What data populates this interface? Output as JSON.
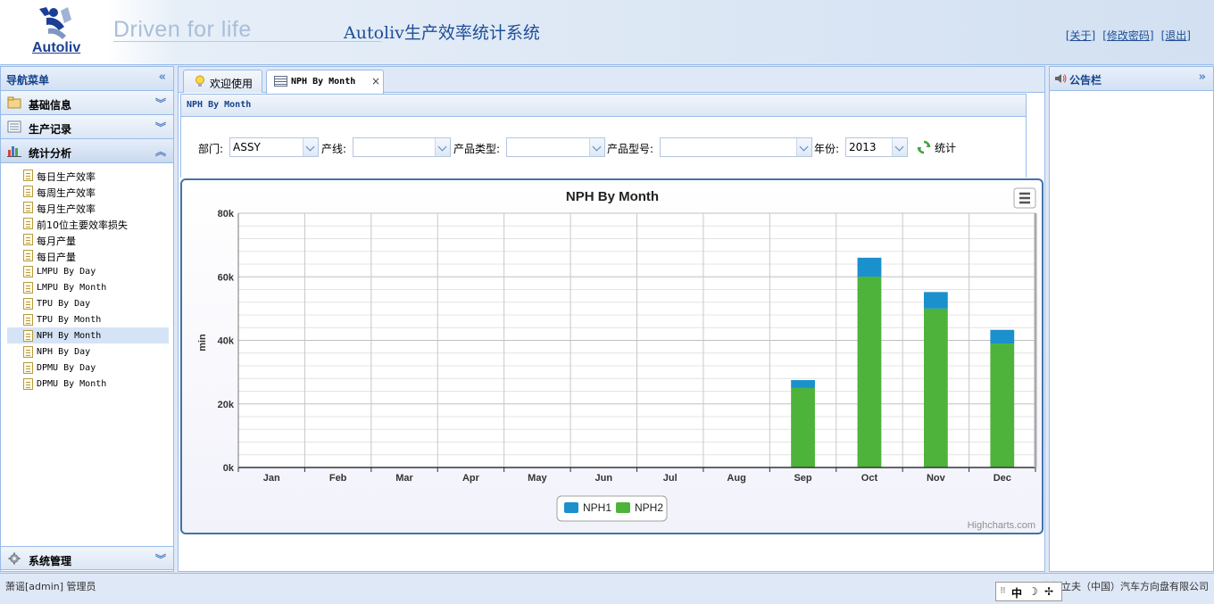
{
  "header": {
    "logo_text": "Autoliv",
    "slogan": "Driven for life",
    "system_title": "Autoliv生产效率统计系统",
    "links": [
      "[关于]",
      "[修改密码]",
      "[退出]"
    ]
  },
  "nav": {
    "title": "导航菜单",
    "sections": [
      {
        "label": "基础信息",
        "icon": "folder-icon",
        "state": "collapsed"
      },
      {
        "label": "生产记录",
        "icon": "list-icon",
        "state": "collapsed"
      },
      {
        "label": "统计分析",
        "icon": "bar-chart-icon",
        "state": "expanded"
      }
    ],
    "items": [
      "每日生产效率",
      "每周生产效率",
      "每月生产效率",
      "前10位主要效率损失",
      "每月产量",
      "每日产量",
      "LMPU By Day",
      "LMPU By Month",
      "TPU By Day",
      "TPU By Month",
      "NPH By Month",
      "NPH By Day",
      "DPMU By Day",
      "DPMU By Month"
    ],
    "selected_item": "NPH By Month",
    "bottom_section": {
      "label": "系统管理",
      "icon": "gear-icon"
    }
  },
  "tabs": [
    {
      "label": "欢迎使用",
      "icon": "lightbulb-icon",
      "active": false
    },
    {
      "label": "NPH By Month",
      "icon": "table-icon",
      "active": true,
      "closable": true
    }
  ],
  "panel": {
    "title": "NPH By Month",
    "filters": {
      "dept_label": "部门:",
      "dept_value": "ASSY",
      "line_label": "产线:",
      "line_value": "",
      "ptype_label": "产品类型:",
      "ptype_value": "",
      "pmodel_label": "产品型号:",
      "pmodel_value": "",
      "year_label": "年份:",
      "year_value": "2013",
      "button_label": "统计"
    }
  },
  "chart_data": {
    "type": "bar",
    "title": "NPH By Month",
    "xlabel": "",
    "ylabel": "min",
    "categories": [
      "Jan",
      "Feb",
      "Mar",
      "Apr",
      "May",
      "Jun",
      "Jul",
      "Aug",
      "Sep",
      "Oct",
      "Nov",
      "Dec"
    ],
    "stacked": true,
    "series": [
      {
        "name": "NPH1",
        "color": "#1a90cc",
        "values": [
          0,
          0,
          0,
          0,
          0,
          0,
          0,
          0,
          2500,
          6000,
          5200,
          4300
        ]
      },
      {
        "name": "NPH2",
        "color": "#4db33a",
        "values": [
          0,
          0,
          0,
          0,
          0,
          0,
          0,
          0,
          25000,
          60000,
          50000,
          39000
        ]
      }
    ],
    "ylim": [
      0,
      80000
    ],
    "yticks": [
      "0k",
      "20k",
      "40k",
      "60k",
      "80k"
    ],
    "grid": true,
    "legend": "bottom-center",
    "credits": "Highcharts.com"
  },
  "board": {
    "title": "公告栏"
  },
  "footer": {
    "user": "萧谣[admin] 管理员",
    "company": "奥托立夫（中国）汽车方向盘有限公司",
    "ime": [
      "中",
      "☽",
      "✢"
    ]
  }
}
